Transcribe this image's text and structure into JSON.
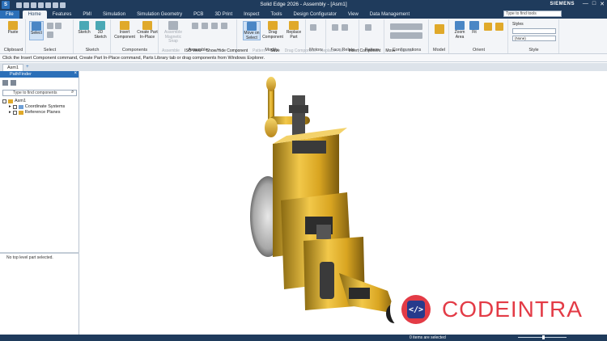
{
  "titlebar": {
    "app_title": "Solid Edge 2026 - Assembly - [Asm1]",
    "brand": "SIEMENS",
    "minimize": "—",
    "maximize": "□",
    "close": "✕"
  },
  "ribbon_tabs": [
    "File",
    "Home",
    "Features",
    "PMI",
    "Simulation",
    "Simulation Geometry",
    "PCB",
    "3D Print",
    "Inspect",
    "Tools",
    "Design Configurator",
    "View",
    "Data Management"
  ],
  "search_tools_placeholder": "Type to find tools",
  "ribbon": {
    "clipboard": {
      "label": "Clipboard",
      "paste": "Paste"
    },
    "select": {
      "label": "Select",
      "select": "Select"
    },
    "sketch": {
      "label": "Sketch",
      "sketch": "Sketch",
      "sketch3d": "3D Sketch"
    },
    "components": {
      "label": "Components",
      "insert": "Insert Component",
      "create_part": "Create Part In-Place"
    },
    "assemble": {
      "label": "Assemble",
      "magnetic": "Assemble Magnetic Snap"
    },
    "modify": {
      "label": "Modify",
      "move_on_select": "Move on Select",
      "drag": "Drag Component",
      "replace": "Replace Part"
    },
    "motors": {
      "label": "Motors"
    },
    "face_relate": {
      "label": "Face Relate"
    },
    "pattern": {
      "label": "Pattern"
    },
    "configurations": {
      "label": "Configurations"
    },
    "model": {
      "label": "Model"
    },
    "orient": {
      "label": "Orient",
      "zoom_area": "Zoom Area",
      "fit": "Fit"
    },
    "style": {
      "label": "Style",
      "styles": "Styles",
      "style_value": "(None)"
    }
  },
  "command_strip": [
    "Assemble",
    "ISO View",
    "Show/Hide Component",
    "Pattern",
    "Save",
    "Drag Component",
    "Replace Part",
    "Insert Component",
    "Move",
    "Delete"
  ],
  "prompt": "Click the Insert Component command, Create Part In-Place command, Parts Library tab or drag components from Windows Explorer.",
  "doc_tab": "Asm1",
  "pathfinder": {
    "title": "PathFinder",
    "search_placeholder": "Type to find components",
    "tree": [
      {
        "label": "Asm1",
        "level": 0
      },
      {
        "label": "Coordinate Systems",
        "level": 1
      },
      {
        "label": "Reference Planes",
        "level": 1
      }
    ],
    "status": "No top level part selected."
  },
  "statusbar": {
    "message": "0 items are selected"
  },
  "overlay": {
    "brand": "CODEINTRA",
    "mark": "</>"
  },
  "colors": {
    "accent": "#1f3b5c",
    "brand_red": "#e33b46",
    "brand_blue": "#273a8c",
    "part_gold": "#e0a92a"
  }
}
